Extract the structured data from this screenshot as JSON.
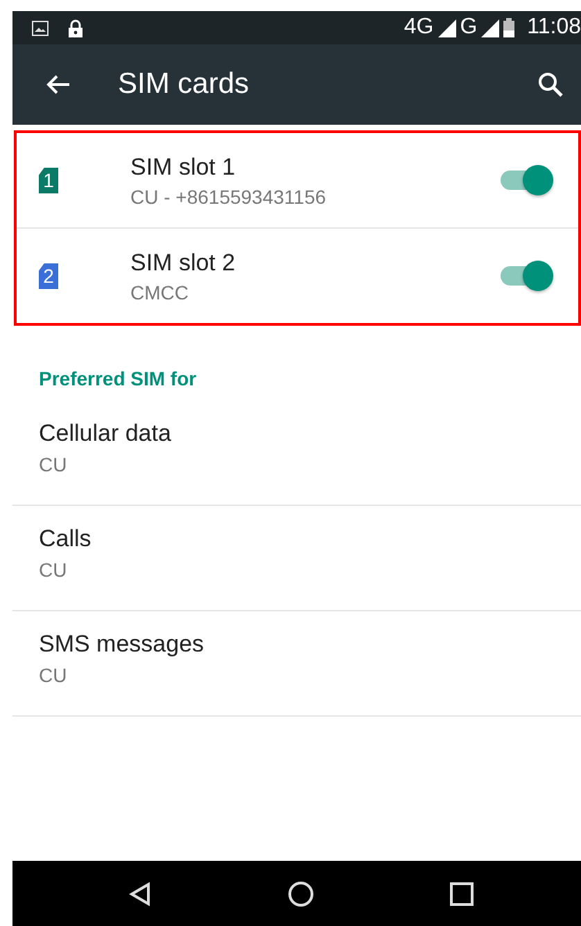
{
  "status_bar": {
    "network": "4G",
    "network_2": "G",
    "time": "11:08"
  },
  "toolbar": {
    "title": "SIM cards"
  },
  "sim_slots": [
    {
      "badge": "1",
      "color": "#0b7a66",
      "title": "SIM slot 1",
      "subtitle": "CU - +8615593431156",
      "on": true
    },
    {
      "badge": "2",
      "color": "#3a6fd8",
      "title": "SIM slot 2",
      "subtitle": "CMCC",
      "on": true
    }
  ],
  "preferred": {
    "header": "Preferred SIM for",
    "items": [
      {
        "title": "Cellular data",
        "value": "CU"
      },
      {
        "title": "Calls",
        "value": "CU"
      },
      {
        "title": "SMS messages",
        "value": "CU"
      }
    ]
  }
}
